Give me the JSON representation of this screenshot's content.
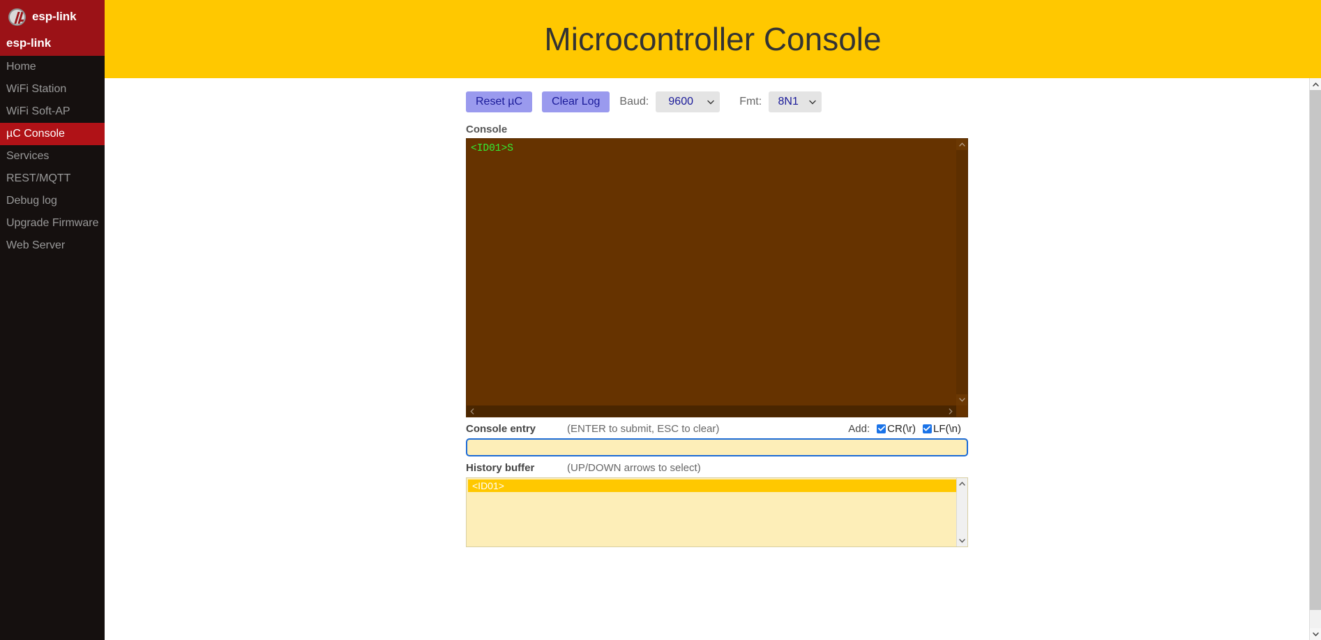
{
  "sidebar": {
    "brand": {
      "logo_icon": "esp-link-logo-icon",
      "text": "esp-link"
    },
    "heading": "esp-link",
    "items": [
      {
        "label": "Home",
        "active": false
      },
      {
        "label": "WiFi Station",
        "active": false
      },
      {
        "label": "WiFi Soft-AP",
        "active": false
      },
      {
        "label": "µC Console",
        "active": true
      },
      {
        "label": "Services",
        "active": false
      },
      {
        "label": "REST/MQTT",
        "active": false
      },
      {
        "label": "Debug log",
        "active": false
      },
      {
        "label": "Upgrade Firmware",
        "active": false
      },
      {
        "label": "Web Server",
        "active": false
      }
    ]
  },
  "header": {
    "title": "Microcontroller Console",
    "background_color": "#ffc800",
    "text_color": "#333333"
  },
  "toolbar": {
    "reset_label": "Reset µC",
    "clear_label": "Clear Log",
    "baud_label": "Baud:",
    "baud_value": "9600",
    "fmt_label": "Fmt:",
    "fmt_value": "8N1",
    "button_color": "#9a9aee",
    "button_text_color": "#1a1a99"
  },
  "console": {
    "label": "Console",
    "text": "<ID01>S",
    "background_color": "#663300",
    "text_color": "#33ee33",
    "scroll_up_icon": "chevron-up-icon",
    "scroll_down_icon": "chevron-down-icon",
    "scroll_left_icon": "chevron-left-icon",
    "scroll_right_icon": "chevron-right-icon"
  },
  "entry": {
    "label": "Console entry",
    "hint": "(ENTER to submit, ESC to clear)",
    "add_label": "Add:",
    "cr_label": "CR(\\r)",
    "cr_checked": true,
    "lf_label": "LF(\\n)",
    "lf_checked": true,
    "input_value": "",
    "input_placeholder": "",
    "focus_color": "#1b6ad6",
    "input_background": "#fdeeb8"
  },
  "history": {
    "label": "History buffer",
    "hint": "(UP/DOWN arrows to select)",
    "items": [
      {
        "text": "<ID01>",
        "selected": true
      }
    ],
    "background_color": "#fdeeb8",
    "selected_color": "#ffc800"
  },
  "page_scrollbar": {
    "up_icon": "chevron-up-icon",
    "down_icon": "chevron-down-icon"
  }
}
